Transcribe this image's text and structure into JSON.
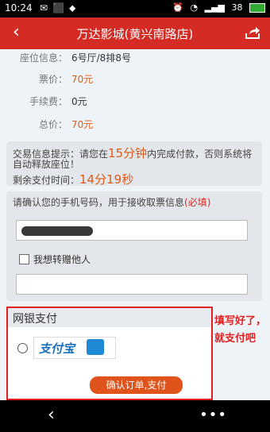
{
  "status": {
    "time": "10:24",
    "signal": "38"
  },
  "nav": {
    "title": "万达影城(黄兴南路店)"
  },
  "info": {
    "seat_label": "座位信息：",
    "seat_value": "6号厅/8排8号",
    "price_label": "票价：",
    "price_value": "70元",
    "fee_label": "手续费：",
    "fee_value": "0元",
    "total_label": "总价：",
    "total_value": "70元"
  },
  "notice": {
    "prefix": "交易信息提示：请您在",
    "minutes": "15分钟",
    "suffix": "内完成付款，否则系统将",
    "line2": "自动释放座位！",
    "remain_label": "剩余支付时间：",
    "remain_value": "14分19秒"
  },
  "phone": {
    "question": "请确认您的手机号码，用于接收取票信息",
    "must": "(必填)",
    "gift_label": "我想转赠他人"
  },
  "pay": {
    "header": "网银支付",
    "alipay_text": "支付宝",
    "confirm": "确认订单,支付"
  },
  "annotation": {
    "line1": "填写好了，",
    "line2": "就支付吧"
  },
  "bottom": {
    "back": "‹",
    "more": "•••"
  }
}
